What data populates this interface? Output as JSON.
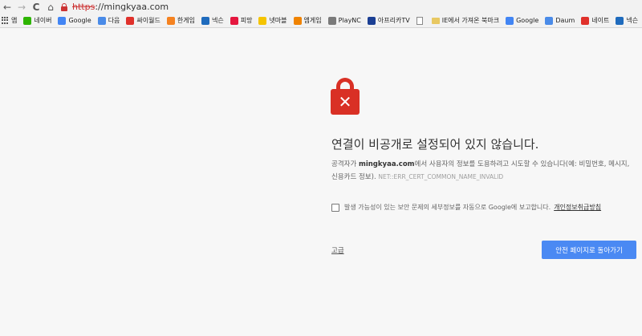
{
  "toolbar": {
    "back": "←",
    "forward": "→",
    "reload": "C",
    "home": "⌂",
    "url_scheme": "https",
    "url_rest": "://mingkyaa.com"
  },
  "bookmarks": [
    {
      "label": "앱",
      "icon": "apps-icon",
      "color": ""
    },
    {
      "label": "네이버",
      "icon": "naver-icon",
      "color": "#2db400"
    },
    {
      "label": "Google",
      "icon": "google-icon",
      "color": "#4285f4"
    },
    {
      "label": "다음",
      "icon": "daum-icon",
      "color": "#4a8be8"
    },
    {
      "label": "싸이월드",
      "icon": "cyworld-icon",
      "color": "#e0312b"
    },
    {
      "label": "한게임",
      "icon": "hangame-icon",
      "color": "#f58220"
    },
    {
      "label": "넥슨",
      "icon": "nexon-icon",
      "color": "#1f6bbd"
    },
    {
      "label": "피망",
      "icon": "pmang-icon",
      "color": "#e5173f"
    },
    {
      "label": "넷마블",
      "icon": "netmarble-icon",
      "color": "#f5c400"
    },
    {
      "label": "엠게임",
      "icon": "mgame-icon",
      "color": "#f08300"
    },
    {
      "label": "PlayNC",
      "icon": "plaync-icon",
      "color": "#7a7a7a"
    },
    {
      "label": "아프리카TV",
      "icon": "afreecatv-icon",
      "color": "#1b3f94"
    },
    {
      "label": "",
      "icon": "page-icon",
      "color": ""
    },
    {
      "label": "IE에서 가져온 북마크",
      "icon": "folder-icon",
      "color": "#e8c862"
    },
    {
      "label": "Google",
      "icon": "google-icon",
      "color": "#4285f4"
    },
    {
      "label": "Daum",
      "icon": "daum-icon",
      "color": "#4a8be8"
    },
    {
      "label": "네이트",
      "icon": "nate-icon",
      "color": "#e0312b"
    },
    {
      "label": "넥슨",
      "icon": "nexon-icon",
      "color": "#1f6bbd"
    }
  ],
  "main": {
    "heading": "연결이 비공개로 설정되어 있지 않습니다.",
    "desc_pre": "공격자가 ",
    "desc_domain": "mingkyaa.com",
    "desc_post": "에서 사용자의 정보를 도용하려고 시도할 수 있습니다(예: 비밀번호, 메시지, 신용카드 정보). ",
    "error_code": "NET::ERR_CERT_COMMON_NAME_INVALID",
    "report_text": "발생 가능성이 있는 보안 문제의 세부정보를 자동으로 Google에 보고합니다.",
    "privacy_link": "개인정보취급방침",
    "advanced": "고급",
    "back_button": "안전 페이지로 돌아가기"
  },
  "colors": {
    "lock_red": "#d93025",
    "button_blue": "#4a89f3"
  }
}
